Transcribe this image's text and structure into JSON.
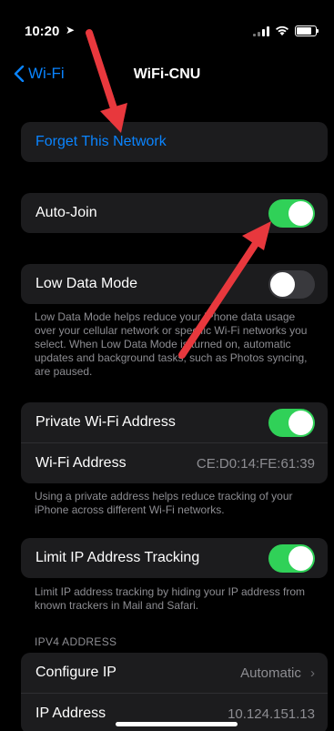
{
  "status_bar": {
    "time": "10:20",
    "location_arrow": "➤",
    "battery_level": 0.9
  },
  "nav": {
    "back_label": "Wi-Fi",
    "title": "WiFi-CNU"
  },
  "forget": {
    "label": "Forget This Network"
  },
  "auto_join": {
    "label": "Auto-Join",
    "on": true
  },
  "low_data": {
    "label": "Low Data Mode",
    "on": false,
    "footnote": "Low Data Mode helps reduce your iPhone data usage over your cellular network or specific Wi-Fi networks you select. When Low Data Mode is turned on, automatic updates and background tasks, such as Photos syncing, are paused."
  },
  "private_addr": {
    "label": "Private Wi-Fi Address",
    "on": true,
    "wifi_address_label": "Wi-Fi Address",
    "wifi_address_value": "CE:D0:14:FE:61:39",
    "footnote": "Using a private address helps reduce tracking of your iPhone across different Wi-Fi networks."
  },
  "limit_ip": {
    "label": "Limit IP Address Tracking",
    "on": true,
    "footnote": "Limit IP address tracking by hiding your IP address from known trackers in Mail and Safari."
  },
  "ipv4": {
    "header": "IPV4 ADDRESS",
    "configure_label": "Configure IP",
    "configure_value": "Automatic",
    "chevron": "›",
    "ip_label": "IP Address",
    "ip_value": "10.124.151.13"
  },
  "colors": {
    "accent": "#0a84ff",
    "toggle_on": "#30d158",
    "annotation": "#e8383d"
  }
}
